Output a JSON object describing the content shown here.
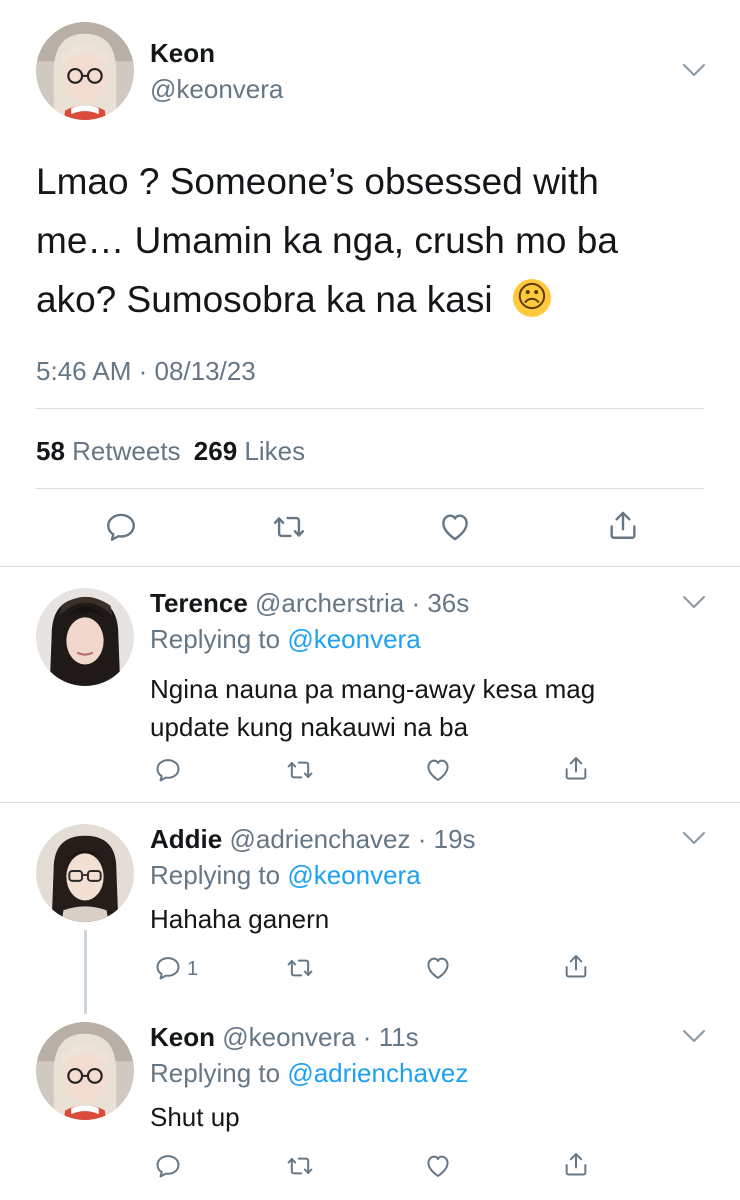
{
  "main_tweet": {
    "name": "Keon",
    "handle": "@keonvera",
    "text_line1": "Lmao ? Someone’s obsessed with",
    "text_line2": "me… Umamin ka nga, crush mo ba",
    "text_line3": "ako? Sumosobra ka na kasi",
    "emoji": "☹",
    "timestamp": "5:46 AM · 08/13/23",
    "retweets_count": "58",
    "retweets_label": "Retweets",
    "likes_count": "269",
    "likes_label": "Likes"
  },
  "replies": [
    {
      "name": "Terence",
      "handle_time": "@archerstria · 36s",
      "replying_prefix": "Replying to",
      "replying_to": "@keonvera",
      "text_line1": "Ngina nauna pa mang-away kesa mag",
      "text_line2": "update kung nakauwi na ba"
    },
    {
      "name": "Addie",
      "handle_time": "@adrienchavez · 19s",
      "replying_prefix": "Replying to",
      "replying_to": "@keonvera",
      "text_line1": "Hahaha ganern",
      "reply_count": "1"
    },
    {
      "name": "Keon",
      "handle_time": "@keonvera · 11s",
      "replying_prefix": "Replying to",
      "replying_to": "@adrienchavez",
      "text_line1": "Shut up"
    }
  ],
  "colors": {
    "accent": "#1da1f2",
    "secondary_text": "#657786",
    "divider": "#d9dee2"
  }
}
